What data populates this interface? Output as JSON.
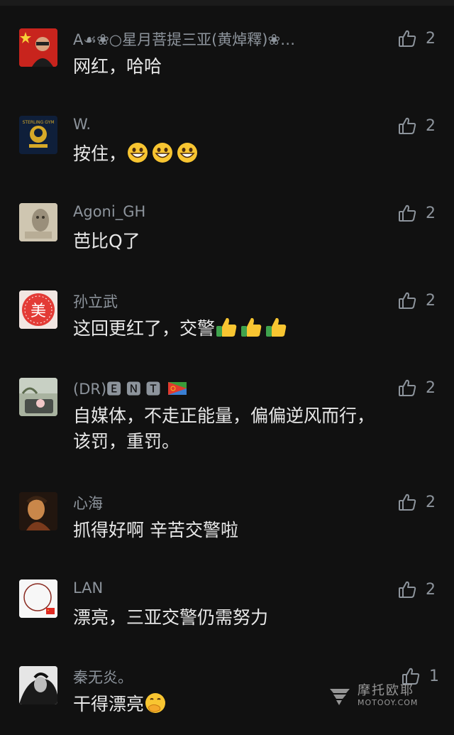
{
  "comments": [
    {
      "name": "A☙❀○星月菩提三亚(黄焯釋)❀…",
      "text": "网红，哈哈",
      "likes": "2"
    },
    {
      "name": "W.",
      "text": "按住，",
      "likes": "2"
    },
    {
      "name": "Agoni_GH",
      "text": "芭比Q了",
      "likes": "2"
    },
    {
      "name": "孙立武",
      "text": "这回更红了，交警",
      "likes": "2"
    },
    {
      "name": "(DR)🅴 🅽 🆃",
      "text": "自媒体，不走正能量，偏偏逆风而行，该罚，重罚。",
      "likes": "2"
    },
    {
      "name": "心海",
      "text": "抓得好啊 辛苦交警啦",
      "likes": "2"
    },
    {
      "name": "LAN",
      "text": "漂亮，三亚交警仍需努力",
      "likes": "2"
    },
    {
      "name": "秦无炎。",
      "text": "干得漂亮",
      "likes": "1"
    }
  ],
  "avatar_labels": {
    "avatar_2": "STERLING GYM",
    "avatar_4": "美"
  },
  "watermark": {
    "cn": "摩托欧耶",
    "en": "MOTOOY.COM"
  },
  "icons": {
    "like": "thumbs-up-icon",
    "emoji_grin": "grinning-face-icon",
    "emoji_thumb": "thumbs-up-emoji-icon",
    "emoji_smirk": "face-with-hand-icon"
  },
  "colors": {
    "background": "#111111",
    "name": "#8d949c",
    "text": "#e8e8e8"
  }
}
